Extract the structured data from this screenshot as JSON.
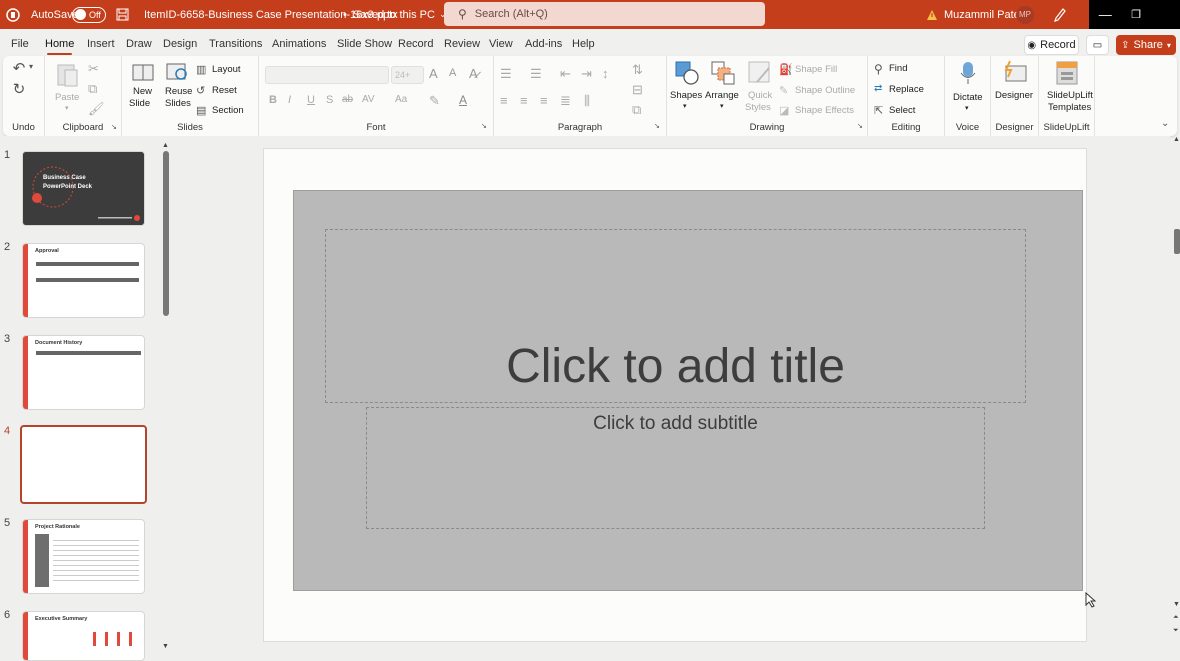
{
  "titlebar": {
    "autosave_label": "AutoSave",
    "autosave_state": "Off",
    "filename": "ItemID-6658-Business Case Presentation-16x9.pptx",
    "separator": "•",
    "save_status": "Saved to this PC",
    "search_placeholder": "Search (Alt+Q)",
    "user_name": "Muzammil Patel",
    "user_initials": "MP",
    "warning_icon": "warning-icon",
    "pen_icon": "pen-icon"
  },
  "menu": {
    "tabs": [
      "File",
      "Home",
      "Insert",
      "Draw",
      "Design",
      "Transitions",
      "Animations",
      "Slide Show",
      "Record",
      "Review",
      "View",
      "Add-ins",
      "Help"
    ],
    "active_tab": "Home",
    "record_label": "Record",
    "share_label": "Share"
  },
  "ribbon": {
    "undo": {
      "group_label": "Undo"
    },
    "clipboard": {
      "group_label": "Clipboard",
      "paste_label": "Paste"
    },
    "slides": {
      "group_label": "Slides",
      "new_slide_l1": "New",
      "new_slide_l2": "Slide",
      "reuse_l1": "Reuse",
      "reuse_l2": "Slides",
      "layout_label": "Layout",
      "reset_label": "Reset",
      "section_label": "Section"
    },
    "font": {
      "group_label": "Font",
      "font_name": "",
      "font_size": "24+",
      "buttons": [
        "B",
        "I",
        "U",
        "S",
        "ab",
        "AV",
        "Aa",
        "A"
      ]
    },
    "paragraph": {
      "group_label": "Paragraph"
    },
    "drawing": {
      "group_label": "Drawing",
      "shapes_label": "Shapes",
      "arrange_label": "Arrange",
      "quick_styles_l1": "Quick",
      "quick_styles_l2": "Styles",
      "shape_fill": "Shape Fill",
      "shape_outline": "Shape Outline",
      "shape_effects": "Shape Effects"
    },
    "editing": {
      "group_label": "Editing",
      "find_label": "Find",
      "replace_label": "Replace",
      "select_label": "Select"
    },
    "voice": {
      "group_label": "Voice",
      "dictate_label": "Dictate"
    },
    "designer": {
      "group_label": "Designer",
      "designer_label": "Designer"
    },
    "slideuplift": {
      "group_label": "SlideUpLift",
      "templates_l1": "SlideUpLift",
      "templates_l2": "Templates"
    }
  },
  "slides": [
    {
      "number": "1",
      "title": "Business Case PowerPoint Deck",
      "selected": false
    },
    {
      "number": "2",
      "title": "Approval",
      "selected": false
    },
    {
      "number": "3",
      "title": "Document History",
      "selected": false
    },
    {
      "number": "4",
      "title": "",
      "selected": true
    },
    {
      "number": "5",
      "title": "Project Rationale",
      "selected": false
    },
    {
      "number": "6",
      "title": "Executive Summary",
      "selected": false
    }
  ],
  "editor": {
    "title_placeholder": "Click to add title",
    "subtitle_placeholder": "Click to add subtitle"
  },
  "colors": {
    "accent": "#c43e1c",
    "selected_thumb": "#b5452a",
    "slide_fill": "#b9b9b9"
  }
}
